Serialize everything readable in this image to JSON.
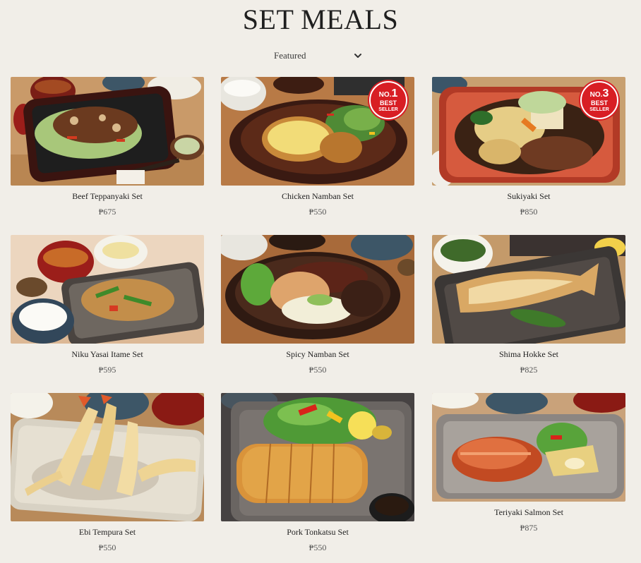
{
  "page": {
    "title": "SET MEALS"
  },
  "sort": {
    "selected": "Featured"
  },
  "badges": {
    "best_label": "BEST",
    "seller_label": "SELLER",
    "no_label": "NO."
  },
  "items": [
    {
      "name": "Beef Teppanyaki Set",
      "price": "₱675",
      "badge_rank": ""
    },
    {
      "name": "Chicken Namban Set",
      "price": "₱550",
      "badge_rank": "1"
    },
    {
      "name": "Sukiyaki Set",
      "price": "₱850",
      "badge_rank": "3"
    },
    {
      "name": "Niku Yasai Itame Set",
      "price": "₱595",
      "badge_rank": ""
    },
    {
      "name": "Spicy Namban Set",
      "price": "₱550",
      "badge_rank": ""
    },
    {
      "name": "Shima Hokke Set",
      "price": "₱825",
      "badge_rank": ""
    },
    {
      "name": "Ebi Tempura Set",
      "price": "₱550",
      "badge_rank": ""
    },
    {
      "name": "Pork Tonkatsu Set",
      "price": "₱550",
      "badge_rank": ""
    },
    {
      "name": "Teriyaki Salmon Set",
      "price": "₱875",
      "badge_rank": ""
    }
  ],
  "icons": {
    "dropdown": "chevron-down-icon"
  }
}
